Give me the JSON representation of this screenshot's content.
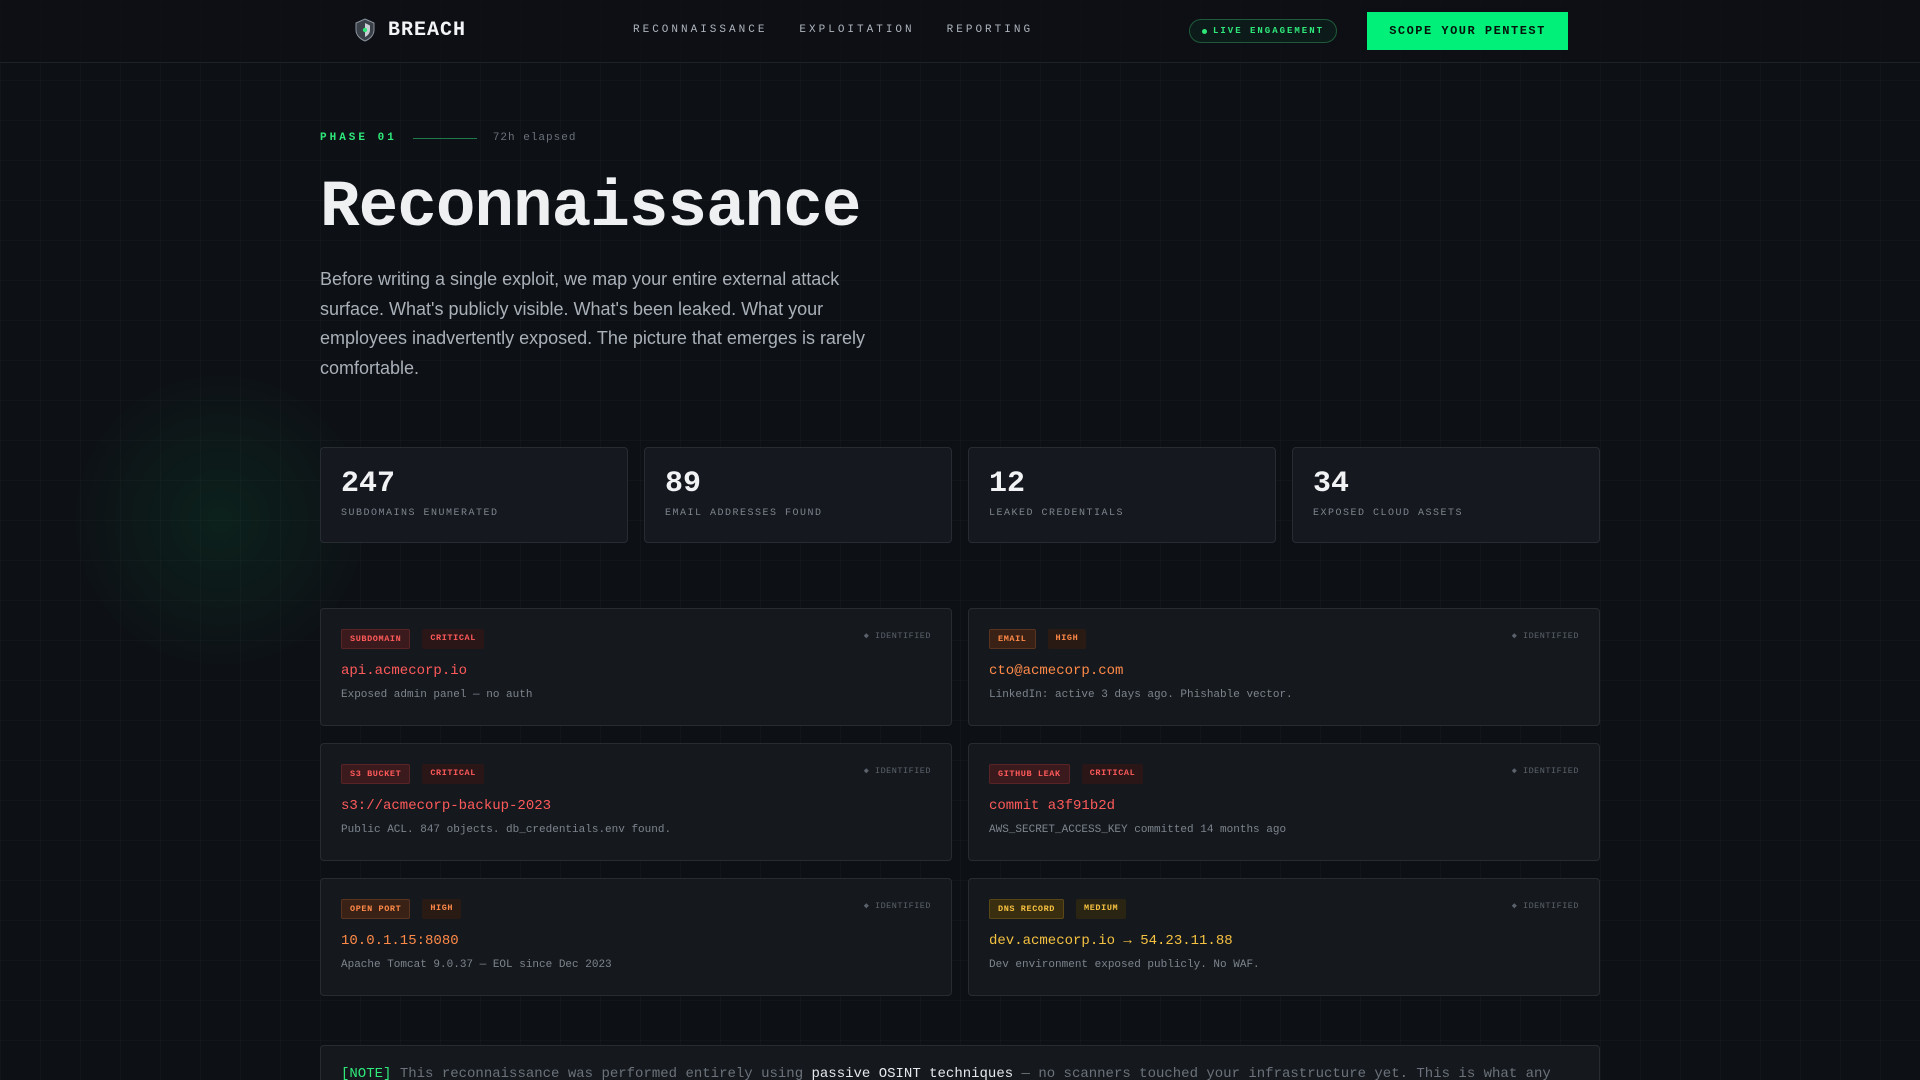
{
  "nav": {
    "brand": "BREACH",
    "links": [
      "RECONNAISSANCE",
      "EXPLOITATION",
      "REPORTING"
    ],
    "live_label": "LIVE ENGAGEMENT",
    "cta_label": "SCOPE YOUR PENTEST"
  },
  "hero": {
    "phase": "PHASE 01",
    "elapsed": "72h elapsed",
    "title": "Reconnaissance",
    "lead": "Before writing a single exploit, we map your entire external attack surface. What's publicly visible. What's been leaked. What your employees inadvertently exposed. The picture that emerges is rarely comfortable."
  },
  "stats": [
    {
      "value": "247",
      "label": "SUBDOMAINS ENUMERATED"
    },
    {
      "value": "89",
      "label": "EMAIL ADDRESSES FOUND"
    },
    {
      "value": "12",
      "label": "LEAKED CREDENTIALS"
    },
    {
      "value": "34",
      "label": "EXPOSED CLOUD ASSETS"
    }
  ],
  "findings": [
    {
      "type": "SUBDOMAIN",
      "severity": "CRITICAL",
      "status": "◆ IDENTIFIED",
      "target": "api.acmecorp.io",
      "desc": "Exposed admin panel — no auth",
      "color": "#ff5a5a"
    },
    {
      "type": "EMAIL",
      "severity": "HIGH",
      "status": "◆ IDENTIFIED",
      "target": "cto@acmecorp.com",
      "desc": "LinkedIn: active 3 days ago. Phishable vector.",
      "color": "#ff8a48"
    },
    {
      "type": "S3 BUCKET",
      "severity": "CRITICAL",
      "status": "◆ IDENTIFIED",
      "target": "s3://acmecorp-backup-2023",
      "desc": "Public ACL. 847 objects. db_credentials.env found.",
      "color": "#ff5a5a"
    },
    {
      "type": "GITHUB LEAK",
      "severity": "CRITICAL",
      "status": "◆ IDENTIFIED",
      "target": "commit a3f91b2d",
      "desc": "AWS_SECRET_ACCESS_KEY committed 14 months ago",
      "color": "#ff5a5a"
    },
    {
      "type": "OPEN PORT",
      "severity": "HIGH",
      "status": "◆ IDENTIFIED",
      "target": "10.0.1.15:8080",
      "desc": "Apache Tomcat 9.0.37 — EOL since Dec 2023",
      "color": "#ff8a48"
    },
    {
      "type": "DNS RECORD",
      "severity": "MEDIUM",
      "status": "◆ IDENTIFIED",
      "target": "dev.acmecorp.io → 54.23.11.88",
      "desc": "Dev environment exposed publicly. No WAF.",
      "color": "#f5c140"
    }
  ],
  "note": {
    "tag": "[NOTE]",
    "text_before": " This reconnaissance was performed entirely using ",
    "strong": "passive OSINT techniques",
    "text_after": " — no scanners touched your infrastructure yet. This is what any"
  }
}
